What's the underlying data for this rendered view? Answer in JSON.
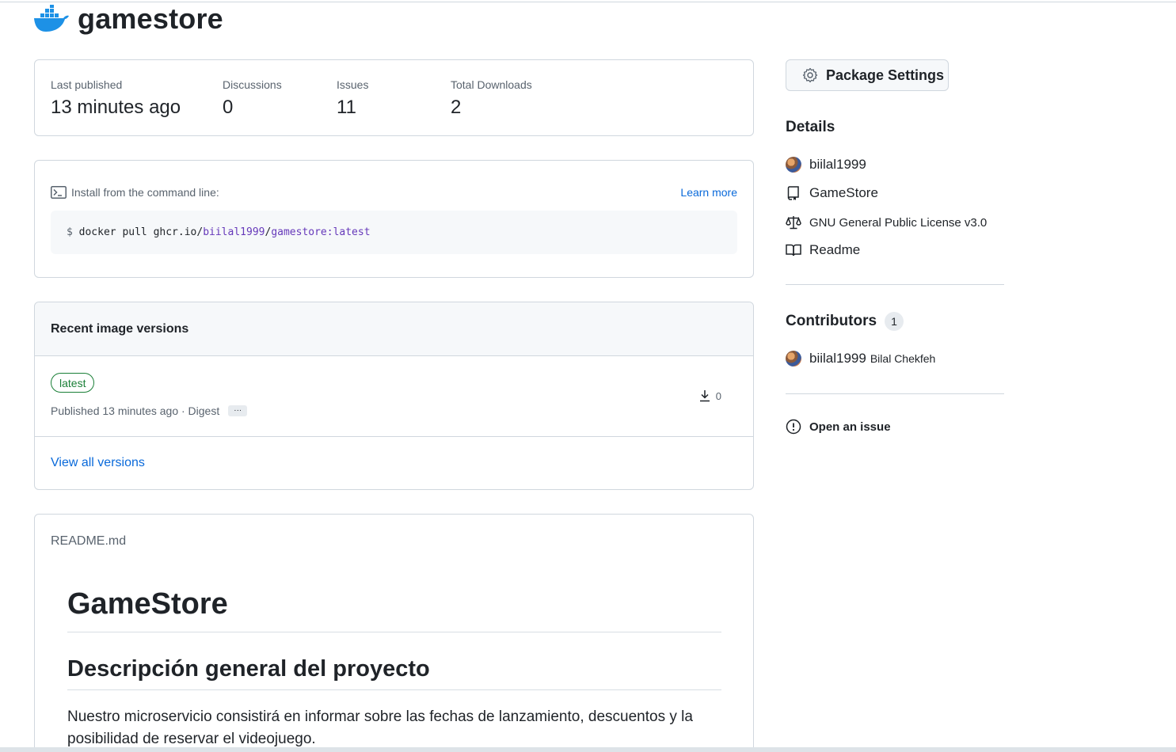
{
  "header": {
    "title": "gamestore",
    "logo_icon": "docker-whale-icon"
  },
  "stats": [
    {
      "label": "Last published",
      "value": "13 minutes ago"
    },
    {
      "label": "Discussions",
      "value": "0"
    },
    {
      "label": "Issues",
      "value": "11"
    },
    {
      "label": "Total Downloads",
      "value": "2"
    }
  ],
  "install": {
    "label": "Install from the command line:",
    "learn_more": "Learn more",
    "prompt": "$",
    "command": "docker pull ghcr.io/",
    "owner": "biilal1999",
    "slash": "/",
    "image": "gamestore:latest"
  },
  "versions": {
    "heading": "Recent image versions",
    "items": [
      {
        "tag": "latest",
        "published": "Published 13 minutes ago · Digest",
        "ellipsis": "···",
        "downloads": "0"
      }
    ],
    "view_all": "View all versions"
  },
  "readme": {
    "filename": "README.md",
    "title": "GameStore",
    "section": "Descripción general del proyecto",
    "paragraph": "Nuestro microservicio consistirá en informar sobre las fechas de lanzamiento, descuentos y la posibilidad de reservar el videojuego."
  },
  "sidebar": {
    "settings_button": "Package Settings",
    "details_heading": "Details",
    "details": [
      {
        "icon": "avatar",
        "label": "biilal1999"
      },
      {
        "icon": "repo-icon",
        "label": "GameStore"
      },
      {
        "icon": "law-icon",
        "label": "GNU General Public License v3.0"
      },
      {
        "icon": "book-icon",
        "label": "Readme"
      }
    ],
    "contributors_heading": "Contributors",
    "contributors_count": "1",
    "contributors": [
      {
        "login": "biilal1999",
        "name": "Bilal Chekfeh"
      }
    ],
    "open_issue": "Open an issue"
  },
  "colors": {
    "link": "#0969da",
    "tag_green": "#1a7f37",
    "docker_blue": "#1d91e6",
    "repo_purple": "#6639ba"
  }
}
